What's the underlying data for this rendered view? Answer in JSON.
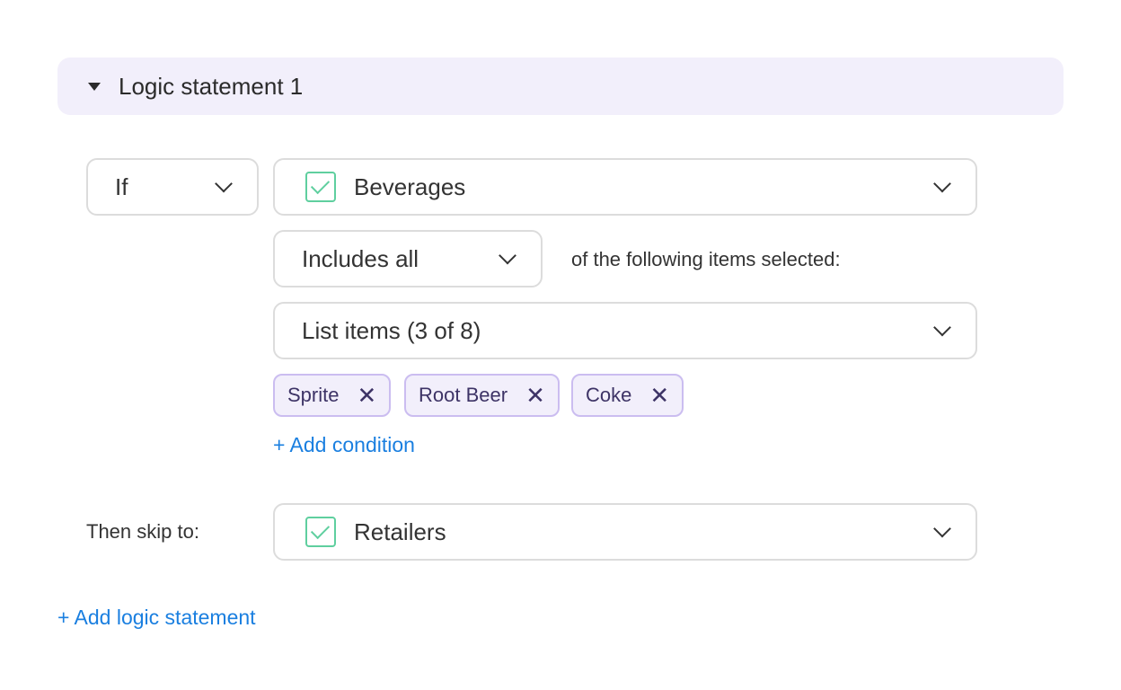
{
  "colors": {
    "header_bg": "#f2effb",
    "check": "#5fcf9f",
    "tag_bg": "#f2effb",
    "tag_border": "#cbbdf0",
    "link": "#1a7fe0"
  },
  "header": {
    "title": "Logic statement 1",
    "icon": "caret-down-icon"
  },
  "condition": {
    "if_select": "If",
    "question_select": "Beverages",
    "operator_select": "Includes all",
    "operator_suffix": "of the following items selected:",
    "items_select": "List items (3 of 8)",
    "tags": [
      {
        "label": "Sprite"
      },
      {
        "label": "Root Beer"
      },
      {
        "label": "Coke"
      }
    ],
    "add_condition": "+ Add condition"
  },
  "then": {
    "label": "Then skip to:",
    "target_select": "Retailers"
  },
  "add_logic_statement": "+ Add logic statement"
}
